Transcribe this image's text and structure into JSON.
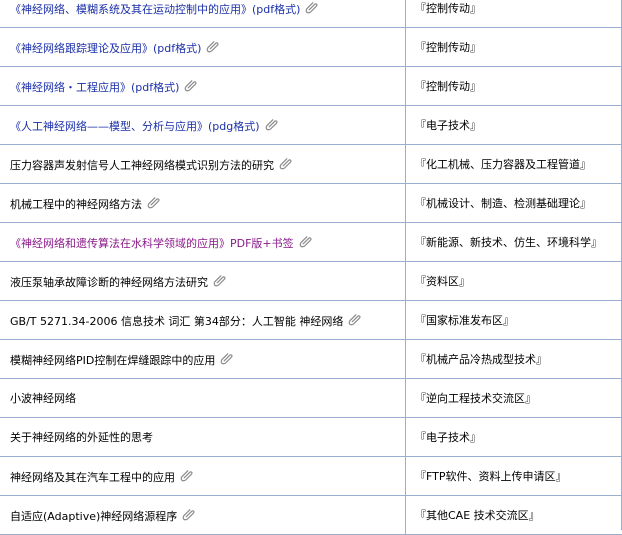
{
  "rows": [
    {
      "title": "《神经网络、模糊系统及其在运动控制中的应用》(pdf格式)",
      "forum": "『控制传动』",
      "color": "blue",
      "attach": true
    },
    {
      "title": "《神经网络跟踪理论及应用》(pdf格式)",
      "forum": "『控制传动』",
      "color": "blue",
      "attach": true
    },
    {
      "title": "《神经网络・工程应用》(pdf格式)",
      "forum": "『控制传动』",
      "color": "blue",
      "attach": true
    },
    {
      "title": "《人工神经网络——模型、分析与应用》(pdg格式)",
      "forum": "『电子技术』",
      "color": "blue",
      "attach": true
    },
    {
      "title": "压力容器声发射信号人工神经网络模式识别方法的研究",
      "forum": "『化工机械、压力容器及工程管道』",
      "color": "black",
      "attach": true
    },
    {
      "title": "机械工程中的神经网络方法",
      "forum": "『机械设计、制造、检测基础理论』",
      "color": "black",
      "attach": true
    },
    {
      "title": "《神经网络和遗传算法在水科学领域的应用》PDF版+书签",
      "forum": "『新能源、新技术、仿生、环境科学』",
      "color": "purple",
      "attach": true
    },
    {
      "title": "液压泵轴承故障诊断的神经网络方法研究",
      "forum": "『资料区』",
      "color": "black",
      "attach": true
    },
    {
      "title": "GB/T 5271.34-2006 信息技术 词汇 第34部分：人工智能 神经网络",
      "forum": "『国家标准发布区』",
      "color": "black",
      "attach": true
    },
    {
      "title": "模糊神经网络PID控制在焊缝跟踪中的应用",
      "forum": "『机械产品冷热成型技术』",
      "color": "black",
      "attach": true
    },
    {
      "title": "小波神经网络",
      "forum": "『逆向工程技术交流区』",
      "color": "black",
      "attach": false
    },
    {
      "title": "关于神经网络的外延性的思考",
      "forum": "『电子技术』",
      "color": "black",
      "attach": false
    },
    {
      "title": "神经网络及其在汽车工程中的应用",
      "forum": "『FTP软件、资料上传申请区』",
      "color": "black",
      "attach": true
    },
    {
      "title": "自适应(Adaptive)神经网络源程序",
      "forum": "『其他CAE 技术交流区』",
      "color": "black",
      "attach": true
    }
  ],
  "colors": {
    "grid_line": "#9aaed0",
    "link_blue": "#1b2fa8",
    "link_purple": "#8a1a8a"
  },
  "icons": {
    "attachment": "paperclip-icon"
  }
}
